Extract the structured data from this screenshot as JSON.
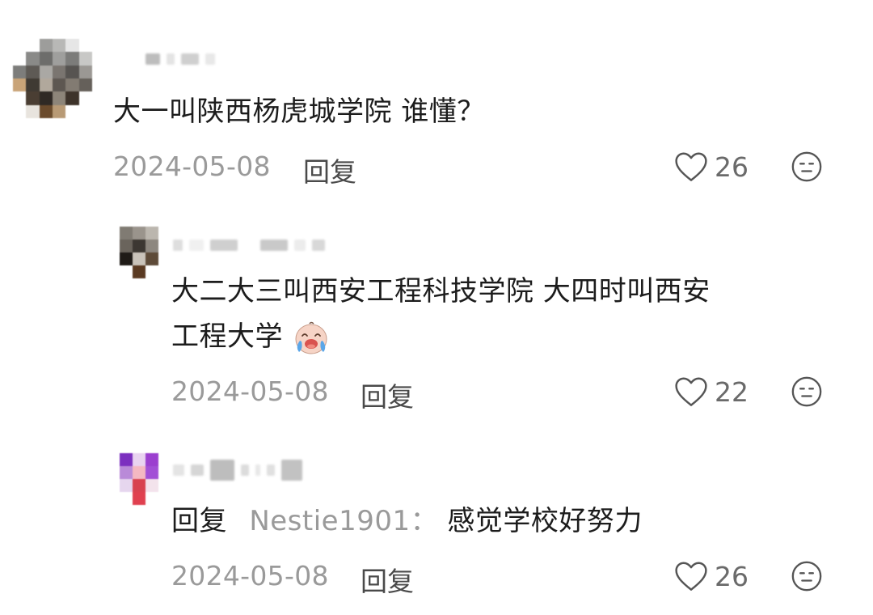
{
  "comments": [
    {
      "text": "大一叫陕西杨虎城学院 谁懂？",
      "date": "2024-05-08",
      "reply_label": "回复",
      "likes": "26"
    },
    {
      "text_line1": "大二大三叫西安工程科技学院 大四时叫西安",
      "text_line2": "工程大学",
      "emoji": "crying-laughing-baby-emoji",
      "date": "2024-05-08",
      "reply_label": "回复",
      "likes": "22"
    },
    {
      "reply_prefix": "回复",
      "reply_target": "Nestie1901",
      "reply_sep": "：",
      "text": "感觉学校好努力",
      "date": "2024-05-08",
      "reply_label": "回复",
      "likes": "26"
    }
  ],
  "icons": {
    "like": "heart-outline-icon",
    "dislike": "meh-face-icon"
  },
  "colors": {
    "text": "#1c1c1c",
    "meta": "#9a9a9a",
    "icon": "#555555"
  }
}
